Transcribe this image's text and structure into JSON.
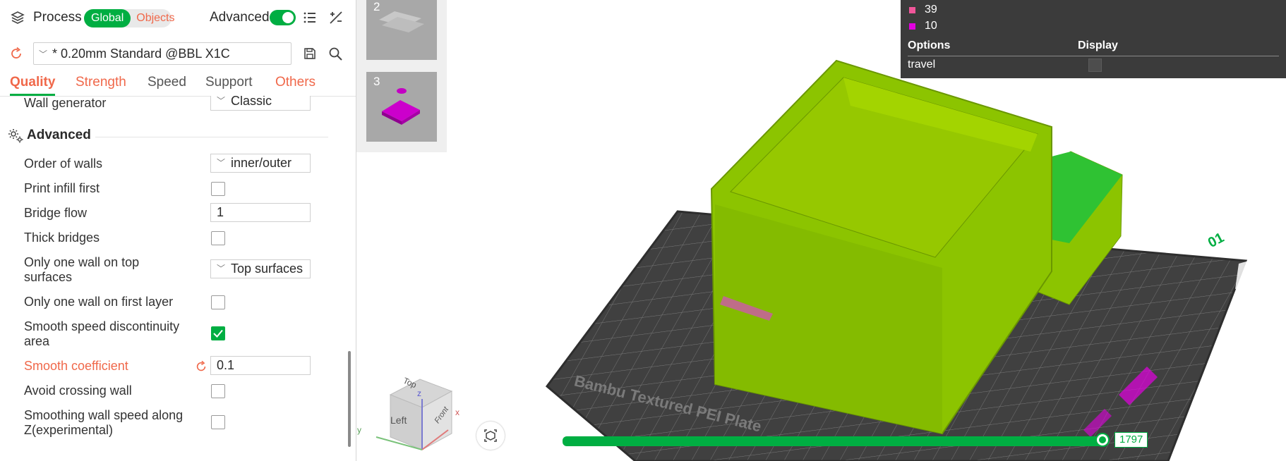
{
  "process": {
    "title": "Process",
    "mode_global": "Global",
    "mode_objects": "Objects",
    "advanced_label": "Advanced",
    "advanced_on": true,
    "preset": "* 0.20mm Standard @BBL X1C"
  },
  "tabs": [
    "Quality",
    "Strength",
    "Speed",
    "Support",
    "Others"
  ],
  "settings": {
    "wall_generator": {
      "label": "Wall generator",
      "value": "Classic"
    },
    "advanced_section": "Advanced",
    "order_of_walls": {
      "label": "Order of walls",
      "value": "inner/outer"
    },
    "print_infill_first": {
      "label": "Print infill first",
      "checked": false
    },
    "bridge_flow": {
      "label": "Bridge flow",
      "value": "1"
    },
    "thick_bridges": {
      "label": "Thick bridges",
      "checked": false
    },
    "only_one_wall_top": {
      "label_line1": "Only one wall on top",
      "label_line2": "surfaces",
      "value": "Top surfaces"
    },
    "only_one_wall_first": {
      "label": "Only one wall on first layer",
      "checked": false
    },
    "smooth_speed": {
      "label_line1": "Smooth speed discontinuity",
      "label_line2": "area",
      "checked": true
    },
    "smooth_coefficient": {
      "label": "Smooth coefficient",
      "value": "0.1"
    },
    "avoid_crossing_wall": {
      "label": "Avoid crossing wall",
      "checked": false
    },
    "smoothing_wall_speed": {
      "label_line1": "Smoothing wall speed along",
      "label_line2": "Z(experimental)",
      "checked": false
    }
  },
  "plates": [
    {
      "number": "2"
    },
    {
      "number": "3"
    }
  ],
  "legend": {
    "items": [
      {
        "label": "39",
        "color": "#f0569a"
      },
      {
        "label": "10",
        "color": "#e200e0"
      }
    ],
    "options_header": "Options",
    "display_header": "Display",
    "option_travel": "travel"
  },
  "viewport": {
    "layer_value": "1797",
    "layer_fraction": 1.0,
    "plate_id": "01",
    "bed_text": "Bambu Textured PEI Plate",
    "cube_labels": {
      "top": "Top",
      "left": "Left",
      "front": "Front"
    },
    "axis_labels": {
      "x": "x",
      "y": "y",
      "z": "z"
    }
  },
  "colors": {
    "accent": "#00ae42",
    "highlight": "#f0684a",
    "model": "#8cc400"
  }
}
